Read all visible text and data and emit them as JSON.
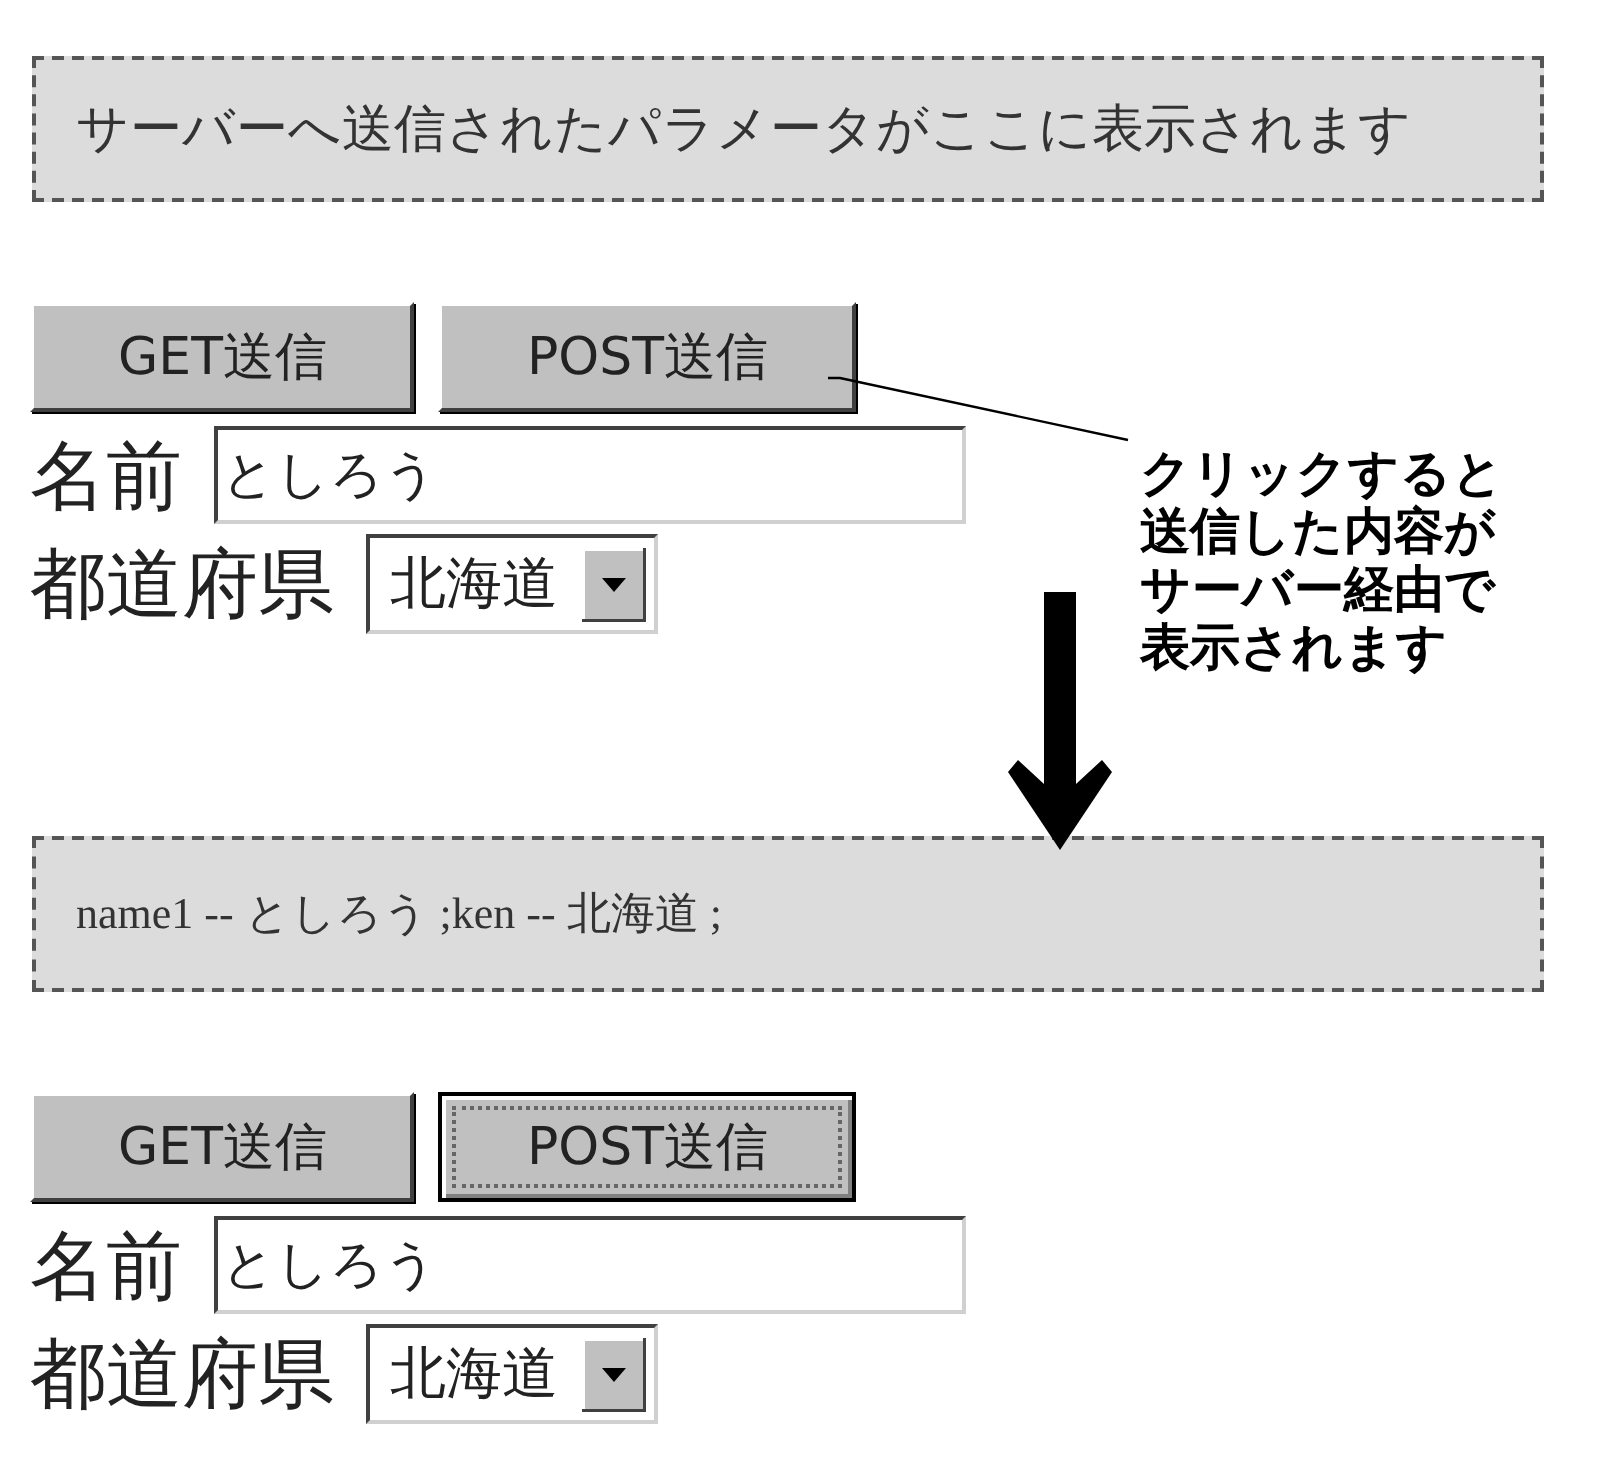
{
  "steps": [
    {
      "output": {
        "kind": "message",
        "text": "サーバーへ送信されたパラメータがここに表示されます"
      },
      "form": {
        "buttons": [
          {
            "label": "GET送信",
            "focused": false
          },
          {
            "label": "POST送信",
            "focused": false
          }
        ],
        "fields": [
          {
            "kind": "text",
            "label": "名前",
            "value": "としろう"
          },
          {
            "kind": "select",
            "label": "都道府県",
            "value": "北海道"
          }
        ]
      }
    },
    {
      "output": {
        "kind": "result",
        "text": "name1 -- としろう ;ken -- 北海道 ;"
      },
      "form": {
        "buttons": [
          {
            "label": "GET送信",
            "focused": false
          },
          {
            "label": "POST送信",
            "focused": true
          }
        ],
        "fields": [
          {
            "kind": "text",
            "label": "名前",
            "value": "としろう"
          },
          {
            "kind": "select",
            "label": "都道府県",
            "value": "北海道"
          }
        ]
      }
    }
  ],
  "callout": {
    "lines": [
      "クリックすると",
      "送信した内容が",
      "サーバー経由で",
      "表示されます"
    ]
  }
}
